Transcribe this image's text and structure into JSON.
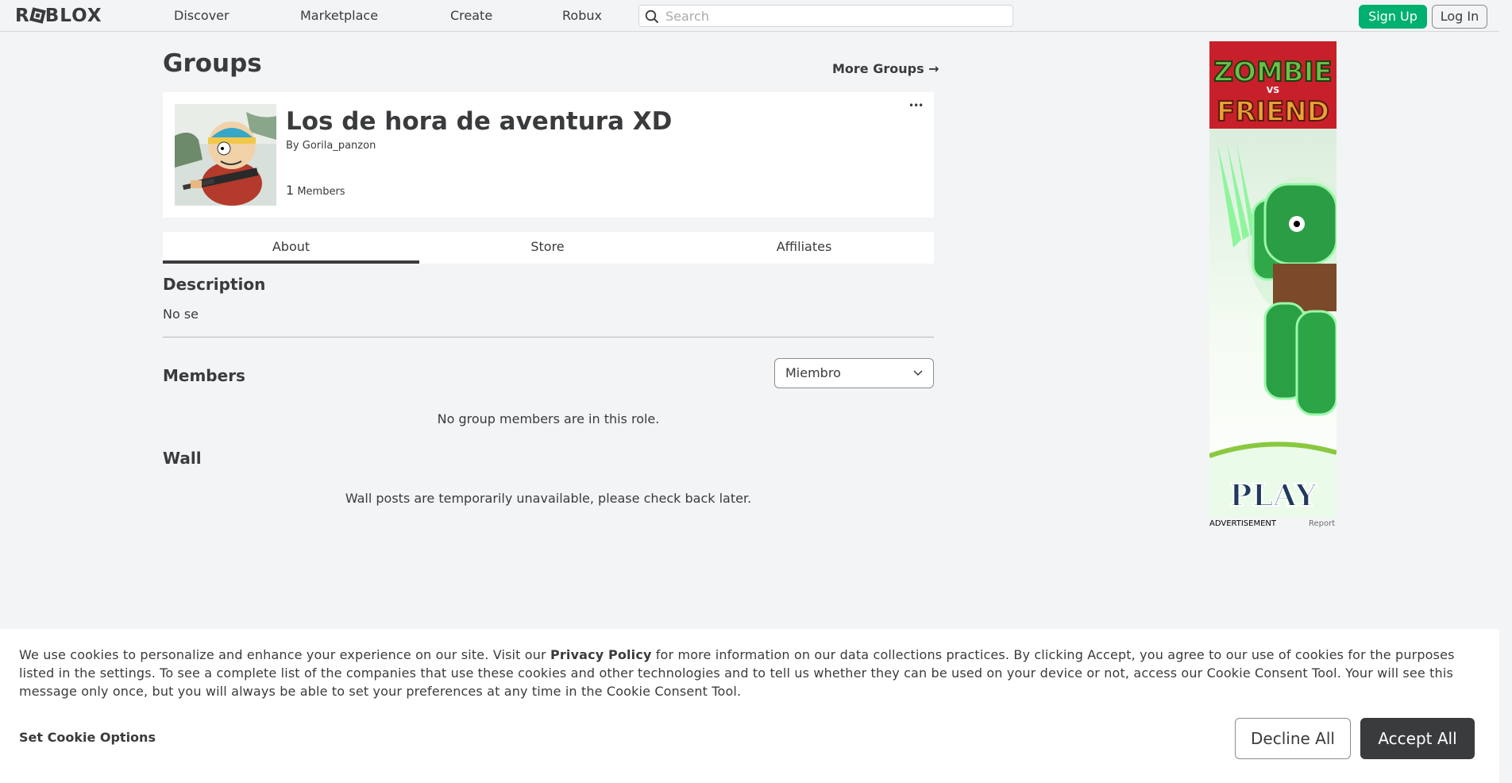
{
  "header": {
    "logo": "ROBLOX",
    "nav": [
      "Discover",
      "Marketplace",
      "Create",
      "Robux"
    ],
    "search_placeholder": "Search",
    "signup_label": "Sign Up",
    "login_label": "Log In"
  },
  "page": {
    "title": "Groups",
    "more_groups": "More Groups →"
  },
  "group": {
    "name": "Los de hora de aventura XD",
    "by_prefix": "By",
    "owner": "Gorila_panzon",
    "member_count": "1",
    "members_label": "Members",
    "more_menu": "•••"
  },
  "tabs": [
    "About",
    "Store",
    "Affiliates"
  ],
  "about": {
    "description_heading": "Description",
    "description_text": "No se",
    "members_heading": "Members",
    "role_selected": "Miembro",
    "no_members_msg": "No group members are in this role.",
    "wall_heading": "Wall",
    "wall_msg": "Wall posts are temporarily unavailable, please check back later."
  },
  "ad": {
    "title_top": "ZOMBIE",
    "title_mid": "VS",
    "title_bottom": "FRIEND",
    "cta": "PLAY",
    "label": "ADVERTISEMENT",
    "report": "Report"
  },
  "cookie": {
    "text_before": "We use cookies to personalize and enhance your experience on our site. Visit our ",
    "privacy_link": "Privacy Policy",
    "text_after": " for more information on our data collections practices. By clicking Accept, you agree to our use of cookies for the purposes listed in the settings. To see a complete list of the companies that use these cookies and other technologies and to tell us whether they can be used on your device or not, access our Cookie Consent Tool. Your will see this message only once, but you will always be able to set your preferences at any time in the Cookie Consent Tool.",
    "set_options": "Set Cookie Options",
    "decline": "Decline All",
    "accept": "Accept All"
  },
  "colors": {
    "accent_green": "#00b06f",
    "text_dark": "#393b3d",
    "page_bg": "#f2f4f5"
  }
}
